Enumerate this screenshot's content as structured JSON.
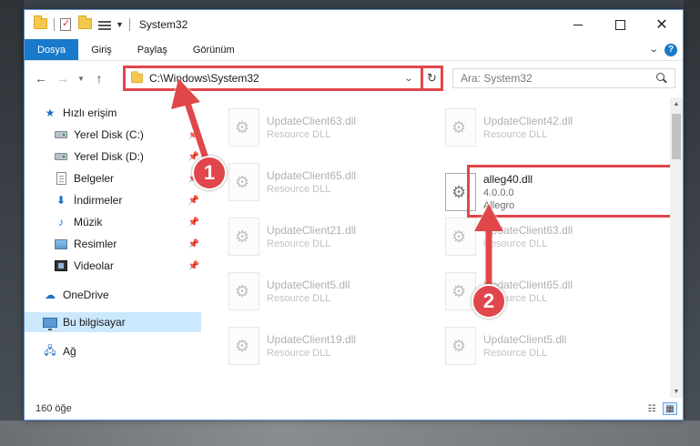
{
  "window": {
    "title": "System32"
  },
  "ribbon": {
    "tabs": [
      "Dosya",
      "Giriş",
      "Paylaş",
      "Görünüm"
    ]
  },
  "address": {
    "path": "C:\\Windows\\System32",
    "search_placeholder": "Ara: System32"
  },
  "sidebar": {
    "quick_access": "Hızlı erişim",
    "items": [
      {
        "label": "Yerel Disk (C:)",
        "icon": "drive-icon",
        "pinned": true
      },
      {
        "label": "Yerel Disk (D:)",
        "icon": "drive-icon",
        "pinned": true
      },
      {
        "label": "Belgeler",
        "icon": "documents-icon",
        "pinned": true
      },
      {
        "label": "İndirmeler",
        "icon": "downloads-icon",
        "pinned": true
      },
      {
        "label": "Müzik",
        "icon": "music-icon",
        "pinned": true
      },
      {
        "label": "Resimler",
        "icon": "pictures-icon",
        "pinned": true
      },
      {
        "label": "Videolar",
        "icon": "videos-icon",
        "pinned": true
      }
    ],
    "onedrive": "OneDrive",
    "this_pc": "Bu bilgisayar",
    "network": "Ağ"
  },
  "files": {
    "left": [
      {
        "name": "UpdateClient63.dll",
        "sub": "Resource DLL"
      },
      {
        "name": "UpdateClient65.dll",
        "sub": "Resource DLL"
      },
      {
        "name": "UpdateClient21.dll",
        "sub": "Resource DLL"
      },
      {
        "name": "UpdateClient5.dll",
        "sub": "Resource DLL"
      },
      {
        "name": "UpdateClient19.dll",
        "sub": "Resource DLL"
      }
    ],
    "right": [
      {
        "name": "UpdateClient42.dll",
        "sub": "Resource DLL"
      },
      {
        "name": "alleg40.dll",
        "sub": "4.0.0.0",
        "sub2": "Allegro",
        "highlight": true
      },
      {
        "name": "UpdateClient63.dll",
        "sub": "Resource DLL"
      },
      {
        "name": "UpdateClient65.dll",
        "sub": "Resource DLL"
      },
      {
        "name": "UpdateClient5.dll",
        "sub": "Resource DLL"
      }
    ]
  },
  "status": {
    "count": "160 öğe"
  },
  "annotations": {
    "step1": "1",
    "step2": "2",
    "color": "#e0464c"
  },
  "colors": {
    "accent": "#1979ca",
    "highlight_red": "#e0464c",
    "selected_bg": "#cce8ff"
  }
}
